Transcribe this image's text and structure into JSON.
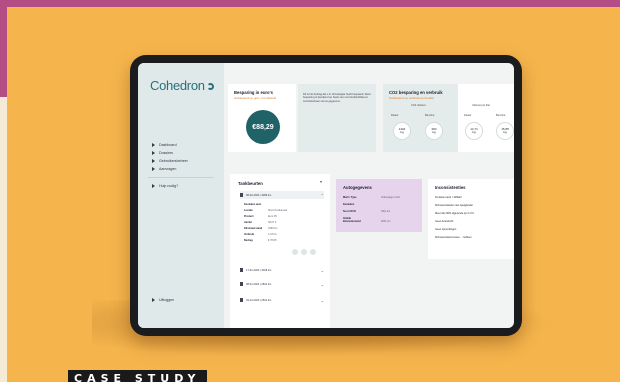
{
  "brand": {
    "logo": "Cohedron"
  },
  "sidebar": {
    "items": [
      {
        "label": "Dashboard"
      },
      {
        "label": "Dossiers"
      },
      {
        "label": "Gebruikersbeheer"
      },
      {
        "label": "Aanvragen"
      },
      {
        "label": "Hulp nodig?"
      }
    ],
    "bottom_item": {
      "label": "Uitloggen"
    }
  },
  "savings": {
    "title": "Besparing in euro's",
    "subtitle": "Gebaseerd op gem. km-afstand",
    "amount": "€88,29",
    "note": "Dit is het bedrag dat u in dit boekjaar heeft bespaard. Deze besparing is berekend op basis van uw brandstofdata en controleerbaar via uw gegevens."
  },
  "co2": {
    "title": "CO2 besparing en verbruik",
    "subtitle": "Gebaseerd op verbruik per bedrijf",
    "label_left": "CO2 uitstoot",
    "label_right": "Uitstoot per liter",
    "stats": [
      {
        "label": "Diesel",
        "value": "1402",
        "unit": "kg"
      },
      {
        "label": "Benzine",
        "value": "284",
        "unit": "kg"
      },
      {
        "label": "Diesel",
        "value": "14,71",
        "unit": "kg"
      },
      {
        "label": "Benzine",
        "value": "15,88",
        "unit": "kg"
      }
    ]
  },
  "tariffs": {
    "title": "Tankbeurten",
    "rows": [
      {
        "label": "08-02-2024 | 3289 km"
      },
      {
        "label": "17-01-2024 | 3018 km"
      },
      {
        "label": "08-01-2024 | 2841 km"
      },
      {
        "label": "04-12-2023 | 2510 km"
      }
    ],
    "details": [
      {
        "key": "Kenteken auto",
        "value": ""
      },
      {
        "key": "Locatie",
        "value": "Shell Oostkanaal"
      },
      {
        "key": "Product",
        "value": "Euro 95"
      },
      {
        "key": "Aantal",
        "value": "38,67 lt"
      },
      {
        "key": "Kilometerstand",
        "value": "3289 km"
      },
      {
        "key": "Verbruik",
        "value": "1:18 km"
      },
      {
        "key": "Bedrag",
        "value": "€ 78,88"
      }
    ]
  },
  "vehicle": {
    "title": "Autogegevens",
    "rows": [
      {
        "key": "Merk / Type",
        "value": "Volkswagen Golf"
      },
      {
        "key": "Kenteken",
        "value": ""
      },
      {
        "key": "Soort OVO",
        "value": "Hdlp km"
      },
      {
        "key": "Initiële kilometerstand",
        "value": "2841 km"
      }
    ]
  },
  "checklist": {
    "title": "Inconsistenties",
    "items": [
      "Kenteken auto = Wittebr",
      "Kilometerstanden niet opeiglandel",
      "Meer dan 90% afgeronde op 4 of 9",
      "Geen Autovlucht",
      "Geen opmerkingen",
      "Kilometerstand tussen ... hebben"
    ]
  },
  "footer": {
    "label": "CASE STUDY"
  }
}
